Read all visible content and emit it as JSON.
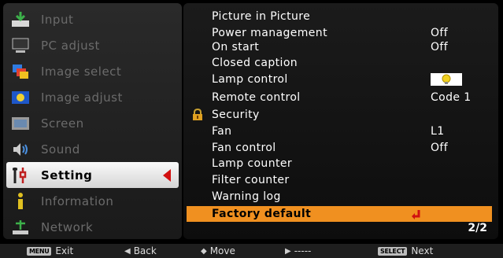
{
  "main_menu": [
    {
      "label": "Input",
      "icon": "input-icon"
    },
    {
      "label": "PC adjust",
      "icon": "pc-adjust-icon"
    },
    {
      "label": "Image select",
      "icon": "image-select-icon"
    },
    {
      "label": "Image adjust",
      "icon": "image-adjust-icon"
    },
    {
      "label": "Screen",
      "icon": "screen-icon"
    },
    {
      "label": "Sound",
      "icon": "sound-icon"
    },
    {
      "label": "Setting",
      "icon": "setting-icon",
      "selected": true
    },
    {
      "label": "Information",
      "icon": "information-icon"
    },
    {
      "label": "Network",
      "icon": "network-icon"
    }
  ],
  "settings": {
    "picture_in_picture": "Picture in Picture",
    "power_management": {
      "label": "Power management",
      "value": "Off"
    },
    "on_start": {
      "label": "On start",
      "value": "Off"
    },
    "closed_caption": "Closed caption",
    "lamp_control": {
      "label": "Lamp control",
      "icon": "lamp-icon"
    },
    "remote_control": {
      "label": "Remote control",
      "value": "Code 1"
    },
    "security": {
      "label": "Security",
      "icon": "lock-icon"
    },
    "fan": {
      "label": "Fan",
      "value": "L1"
    },
    "fan_control": {
      "label": "Fan control",
      "value": "Off"
    },
    "lamp_counter": "Lamp counter",
    "filter_counter": "Filter counter",
    "warning_log": "Warning log",
    "factory_default": "Factory default",
    "page": "2/2"
  },
  "bottom_bar": {
    "menu_key": "MENU",
    "exit": "Exit",
    "back": "Back",
    "move": "Move",
    "dashes": "-----",
    "select_key": "SELECT",
    "next": "Next"
  },
  "colors": {
    "highlight": "#f09020",
    "selected_arrow": "#d21010",
    "menu_dim_text": "#6b6b6b"
  }
}
